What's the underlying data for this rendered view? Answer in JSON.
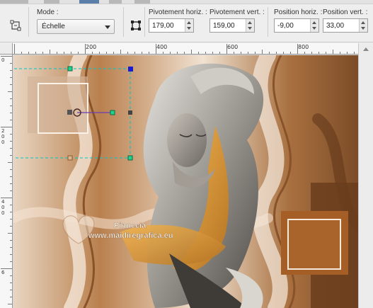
{
  "toolbar": {
    "mode_label": "Mode :",
    "mode_value": "Échelle",
    "fields": [
      {
        "label": "Pivotement horiz. :",
        "value": "179,00"
      },
      {
        "label": "Pivotement vert. :",
        "value": "159,00"
      },
      {
        "label": "Position horiz. :",
        "value": "-9,00"
      },
      {
        "label": "Position vert. :",
        "value": "33,00"
      }
    ]
  },
  "ruler": {
    "h_labels": [
      "200",
      "400",
      "600",
      "800"
    ],
    "v_labels": [
      "0",
      "2",
      "0",
      "0",
      "4",
      "0",
      "0",
      "6"
    ]
  },
  "watermark": {
    "line1": "Pinuccia",
    "line2": "www.maidiregrafica.eu"
  },
  "colors": {
    "accent": "#5b7fa8",
    "canvas_brown": "#8a5a32",
    "gizmo_cyan": "#00c8c8",
    "gizmo_green": "#1fd18a",
    "gizmo_blue": "#1a1ad0"
  },
  "icons": {
    "tool": "pick-tool-icon",
    "reset": "reset-transform-icon"
  }
}
